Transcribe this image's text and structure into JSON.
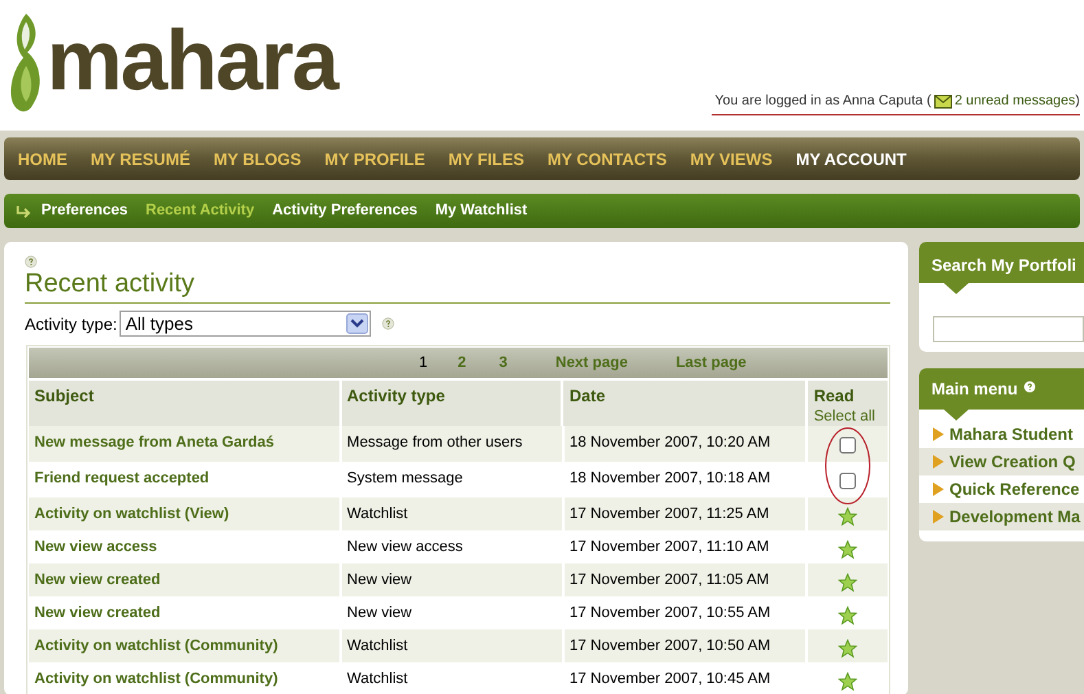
{
  "logo": {
    "text": "mahara"
  },
  "login": {
    "prefix": "You are logged in as Anna Caputa (",
    "messages_link": "2 unread messages",
    "suffix": ")"
  },
  "main_nav": [
    {
      "label": "HOME",
      "selected": false
    },
    {
      "label": "MY RESUMÉ",
      "selected": false
    },
    {
      "label": "MY BLOGS",
      "selected": false
    },
    {
      "label": "MY PROFILE",
      "selected": false
    },
    {
      "label": "MY FILES",
      "selected": false
    },
    {
      "label": "MY CONTACTS",
      "selected": false
    },
    {
      "label": "MY VIEWS",
      "selected": false
    },
    {
      "label": "MY ACCOUNT",
      "selected": true
    }
  ],
  "sub_nav": [
    {
      "label": "Preferences",
      "selected": false
    },
    {
      "label": "Recent Activity",
      "selected": true
    },
    {
      "label": "Activity Preferences",
      "selected": false
    },
    {
      "label": "My Watchlist",
      "selected": false
    }
  ],
  "page": {
    "title": "Recent activity",
    "filter_label": "Activity type:",
    "filter_value": "All types"
  },
  "pagination": [
    {
      "label": "1",
      "selected": true
    },
    {
      "label": "2",
      "selected": false
    },
    {
      "label": "3",
      "selected": false
    },
    {
      "label": "Next page",
      "selected": false
    },
    {
      "label": "Last page",
      "selected": false
    }
  ],
  "table": {
    "columns": [
      "Subject",
      "Activity type",
      "Date",
      "Read"
    ],
    "select_all": "Select all",
    "rows": [
      {
        "subject": "New message from Aneta Gardaś",
        "type": "Message from other users",
        "date": "18 November 2007, 10:20 AM",
        "read": false
      },
      {
        "subject": "Friend request accepted",
        "type": "System message",
        "date": "18 November 2007, 10:18 AM",
        "read": false
      },
      {
        "subject": "Activity on watchlist (View)",
        "type": "Watchlist",
        "date": "17 November 2007, 11:25 AM",
        "read": true
      },
      {
        "subject": "New view access",
        "type": "New view access",
        "date": "17 November 2007, 11:10 AM",
        "read": true
      },
      {
        "subject": "New view created",
        "type": "New view",
        "date": "17 November 2007, 11:05 AM",
        "read": true
      },
      {
        "subject": "New view created",
        "type": "New view",
        "date": "17 November 2007, 10:55 AM",
        "read": true
      },
      {
        "subject": "Activity on watchlist (Community)",
        "type": "Watchlist",
        "date": "17 November 2007, 10:50 AM",
        "read": true
      },
      {
        "subject": "Activity on watchlist (Community)",
        "type": "Watchlist",
        "date": "17 November 2007, 10:45 AM",
        "read": true
      }
    ]
  },
  "sidebar": {
    "search_title": "Search My Portfoli",
    "menu_title": "Main menu",
    "menu_items": [
      "Mahara Student",
      "View Creation Q",
      "Quick Reference",
      "Development Ma"
    ]
  }
}
